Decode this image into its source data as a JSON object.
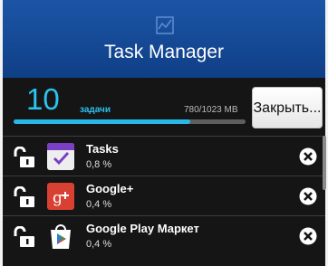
{
  "header": {
    "logo_icon": "chart-logo-icon",
    "title": "Task Manager"
  },
  "summary": {
    "task_count": "10",
    "task_label": "задачи",
    "memory": "780/1023 MB",
    "memory_fraction": 0.7625,
    "close_label": "Закрыть..."
  },
  "colors": {
    "header": "#1c55a6",
    "accent": "#2bc3f0",
    "background": "#151515"
  },
  "apps": [
    {
      "name": "Tasks",
      "usage": "0,8 %",
      "icon": "tasks-app-icon",
      "lock_icon": "unlock-icon",
      "kill_icon": "close-circle-icon"
    },
    {
      "name": "Google+",
      "usage": "0,4 %",
      "icon": "google-plus-app-icon",
      "lock_icon": "unlock-icon",
      "kill_icon": "close-circle-icon"
    },
    {
      "name": "Google Play Маркет",
      "usage": "0,4 %",
      "icon": "google-play-app-icon",
      "lock_icon": "unlock-icon",
      "kill_icon": "close-circle-icon"
    }
  ]
}
